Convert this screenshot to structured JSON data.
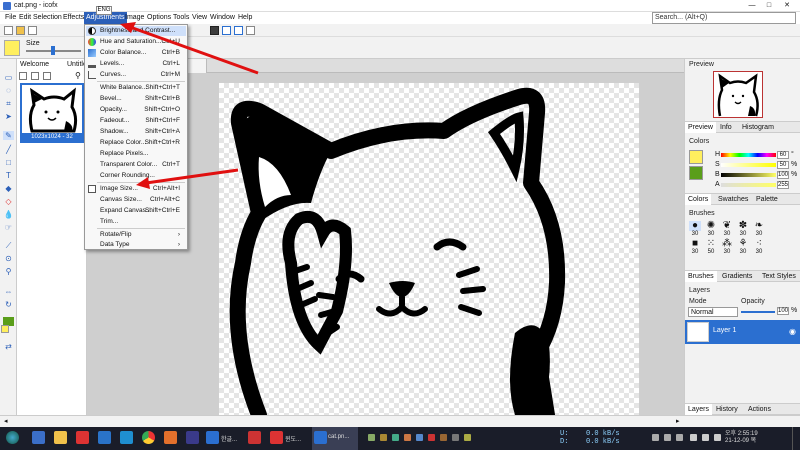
{
  "window": {
    "title": "cat.png - icofx",
    "minimize": "—",
    "maximize": "□",
    "close": "✕"
  },
  "ime_indicator": "ENG",
  "menubar": {
    "items": [
      "File",
      "Edit",
      "Selection",
      "Effects",
      "Adjustments",
      "Image",
      "Options",
      "Tools",
      "View",
      "Window",
      "Help"
    ],
    "active_index": 4,
    "search_placeholder": "Search... (Alt+Q)"
  },
  "options_bar": {
    "size_label": "Size",
    "primary_color": "#ffef5e"
  },
  "doc_panel": {
    "tabs": [
      "Welcome",
      "Untitle"
    ],
    "thumb_caption": "1023x1024 - 32"
  },
  "adjustments_menu": {
    "items": [
      {
        "label": "Brightness and Contrast...",
        "shortcut": "",
        "icon": "brightness-icon",
        "highlight": true
      },
      {
        "label": "Hue and Saturation...",
        "shortcut": "Ctrl+U",
        "icon": "hue-icon"
      },
      {
        "label": "Color Balance...",
        "shortcut": "Ctrl+B",
        "icon": "color-balance-icon"
      },
      {
        "label": "Levels...",
        "shortcut": "Ctrl+L",
        "icon": "levels-icon"
      },
      {
        "label": "Curves...",
        "shortcut": "Ctrl+M",
        "icon": "curves-icon"
      },
      {
        "label": "White Balance...",
        "shortcut": "Shift+Ctrl+T",
        "icon": ""
      },
      {
        "label": "Bevel...",
        "shortcut": "Shift+Ctrl+B",
        "icon": ""
      },
      {
        "label": "Opacity...",
        "shortcut": "Shift+Ctrl+O",
        "icon": ""
      },
      {
        "label": "Fadeout...",
        "shortcut": "Shift+Ctrl+F",
        "icon": ""
      },
      {
        "label": "Shadow...",
        "shortcut": "Shift+Ctrl+A",
        "icon": ""
      },
      {
        "label": "Replace Color...",
        "shortcut": "Shift+Ctrl+R",
        "icon": ""
      },
      {
        "label": "Replace Pixels...",
        "shortcut": "",
        "icon": ""
      },
      {
        "label": "Transparent Color...",
        "shortcut": "Ctrl+T",
        "icon": ""
      },
      {
        "label": "Corner Rounding...",
        "shortcut": "",
        "icon": ""
      },
      {
        "label": "Image Size...",
        "shortcut": "Ctrl+Alt+I",
        "icon": "image-size-icon"
      },
      {
        "label": "Canvas Size...",
        "shortcut": "Ctrl+Alt+C",
        "icon": ""
      },
      {
        "label": "Expand Canvas...",
        "shortcut": "Shift+Ctrl+E",
        "icon": ""
      },
      {
        "label": "Trim...",
        "shortcut": "",
        "icon": ""
      },
      {
        "label": "Rotate/Flip",
        "shortcut": "›",
        "icon": ""
      },
      {
        "label": "Data Type",
        "shortcut": "›",
        "icon": ""
      }
    ]
  },
  "right_panel": {
    "preview_title": "Preview",
    "preview_tabs": [
      "Preview",
      "Info",
      "Histogram"
    ],
    "colors_title": "Colors",
    "colors": [
      {
        "label": "H",
        "value": "60",
        "unit": "°"
      },
      {
        "label": "S",
        "value": "50",
        "unit": "%"
      },
      {
        "label": "B",
        "value": "100",
        "unit": "%"
      },
      {
        "label": "A",
        "value": "255",
        "unit": ""
      }
    ],
    "colors_tabs": [
      "Colors",
      "Swatches",
      "Palette"
    ],
    "brushes_title": "Brushes",
    "brush_sizes": [
      "30",
      "30",
      "30",
      "30",
      "30",
      "30",
      "50",
      "30",
      "30",
      "30"
    ],
    "brushes_tabs": [
      "Brushes",
      "Gradients",
      "Text Styles"
    ],
    "layers_title": "Layers",
    "mode_label": "Mode",
    "mode_value": "Normal",
    "opacity_label": "Opacity",
    "opacity_value": "100",
    "opacity_unit": "%",
    "layer_name": "Layer 1",
    "layers_tabs": [
      "Layers",
      "History",
      "Actions"
    ]
  },
  "taskbar": {
    "labels": [
      "한글...",
      "윈도...",
      "cat.pn..."
    ],
    "net_u": "U:",
    "net_d": "D:",
    "net_up": "0.0 kB/s",
    "net_down": "0.0 kB/s",
    "clock_time": "오후 2:55:19",
    "clock_date": "21-12-09 목"
  }
}
